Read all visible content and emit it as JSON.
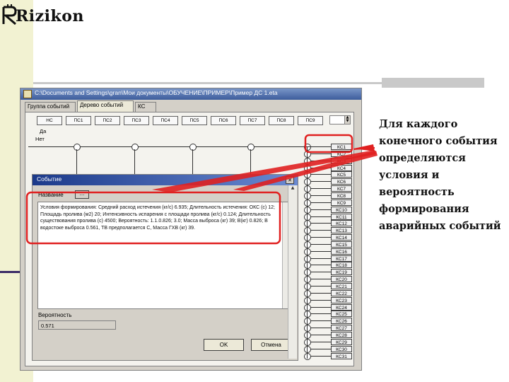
{
  "logo": {
    "text": "Rizikon"
  },
  "app": {
    "title": "C:\\Documents and Settings\\gran\\Мои документы\\ОБУЧЕНИЕ\\ПРИМЕР\\Пример ДС 1.eta",
    "tabs": [
      "Группа событий",
      "Дерево событий",
      "КС"
    ],
    "active_tab": "Дерево событий",
    "columns": [
      "НС",
      "ПС1",
      "ПС2",
      "ПС3",
      "ПС4",
      "ПС5",
      "ПС6",
      "ПС7",
      "ПС8",
      "ПС9"
    ],
    "legend_yes": "Да",
    "legend_no": "Нет",
    "kc_items": [
      "КС1",
      "КС2",
      "КС3",
      "КС4",
      "КС5",
      "КС6",
      "КС7",
      "КС8",
      "КС9",
      "КС10",
      "КС11",
      "КС12",
      "КС13",
      "КС14",
      "КС15",
      "КС16",
      "КС17",
      "КС18",
      "КС19",
      "КС20",
      "КС21",
      "КС22",
      "КС23",
      "КС24",
      "КС25",
      "КС26",
      "КС27",
      "КС28",
      "КС29",
      "КС30",
      "КС31"
    ]
  },
  "dialog": {
    "title": "Событие",
    "name_label": "Название",
    "dots_button": "...",
    "description": "Условия формирования: Средний расход истечения (кг/с) 6.935; Длительность истечения: ОКС (с) 12; Площадь пролива (м2) 20; Интенсивность испарения с площади пролива (кг/с) 0.124; Длительность существования пролива (с) 4500; Вероятность: 1.1.0.826; 3.0; Масса выброса (кг) 39; В(кг) 0.826; В водостоке выброса 0.561, ТВ предполагается С, Масса ГХВ (кг) 39.",
    "probability_label": "Вероятность",
    "probability_value": "0.571",
    "ok_label": "OK",
    "cancel_label": "Отмена"
  },
  "annotation": {
    "text": "Для каждого конечного события определяются условия и вероятность формирования аварийных событий"
  }
}
